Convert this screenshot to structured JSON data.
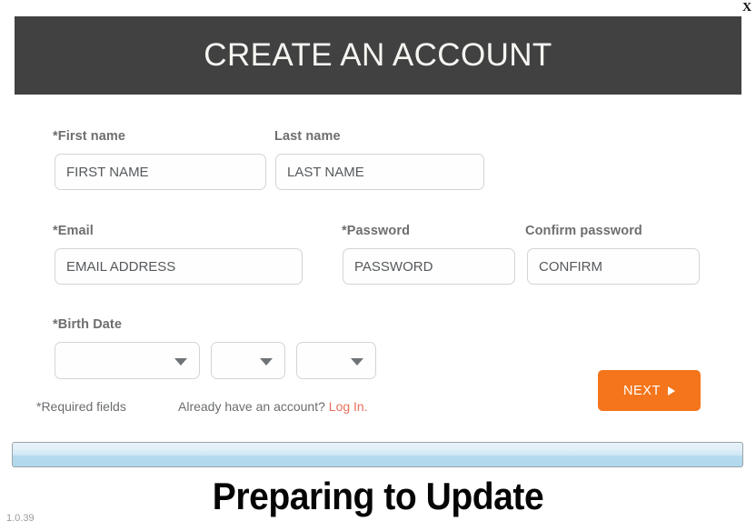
{
  "window": {
    "close_label": "X"
  },
  "header": {
    "title": "CREATE AN ACCOUNT"
  },
  "form": {
    "fields": [
      {
        "label": "*First name",
        "placeholder": "FIRST NAME",
        "value": ""
      },
      {
        "label": "Last name",
        "placeholder": "LAST NAME",
        "value": ""
      },
      {
        "label": "*Email",
        "placeholder": "EMAIL ADDRESS",
        "value": ""
      },
      {
        "label": "*Password",
        "placeholder": "PASSWORD",
        "value": ""
      },
      {
        "label": "Confirm password",
        "placeholder": "CONFIRM",
        "value": ""
      }
    ],
    "birth_date": {
      "label": "*Birth Date",
      "selects": [
        {
          "value": ""
        },
        {
          "value": ""
        },
        {
          "value": ""
        }
      ]
    },
    "required_note": "*Required fields",
    "account_note": "Already have an account?",
    "login_link": "Log In.",
    "next_button": "NEXT"
  },
  "updater": {
    "status": "Preparing to Update",
    "progress_percent": 100,
    "version": "1.0.39"
  },
  "colors": {
    "header_bg": "#414141",
    "accent_orange": "#f4751b",
    "link_red": "#e8705a",
    "progress_blue": "#b0d8ec",
    "label_gray": "#6e6e6e"
  }
}
